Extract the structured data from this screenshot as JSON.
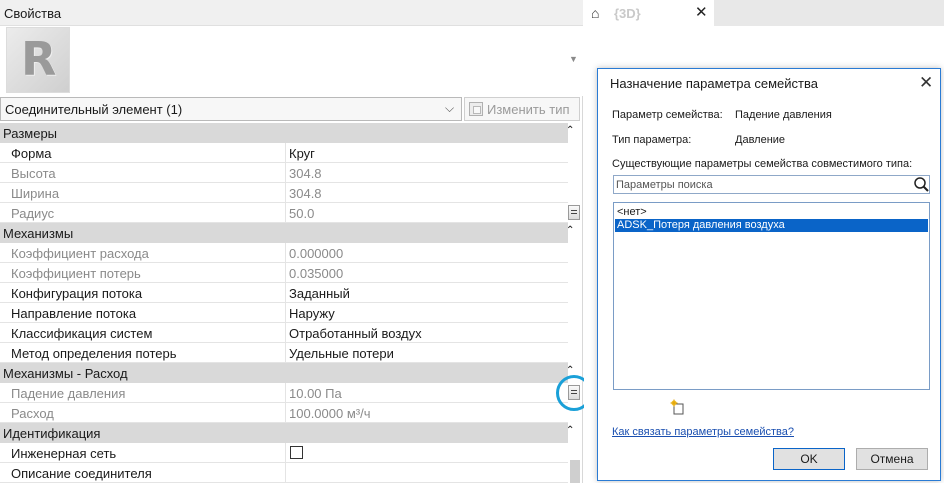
{
  "properties_palette": {
    "title": "Свойства",
    "type_thumbnail_letter": "R",
    "selector_label": "Соединительный элемент (1)",
    "edit_type_label": "Изменить тип",
    "groups": [
      {
        "label": "Размеры",
        "rows": [
          {
            "name": "Форма",
            "value": "Круг",
            "dim": false
          },
          {
            "name": "Высота",
            "value": "304.8",
            "dim": true
          },
          {
            "name": "Ширина",
            "value": "304.8",
            "dim": true
          },
          {
            "name": "Радиус",
            "value": "50.0",
            "dim": true,
            "assoc": true
          }
        ]
      },
      {
        "label": "Механизмы",
        "rows": [
          {
            "name": "Коэффициент расхода",
            "value": "0.000000",
            "dim": true
          },
          {
            "name": "Коэффициент потерь",
            "value": "0.035000",
            "dim": true
          },
          {
            "name": "Конфигурация потока",
            "value": "Заданный",
            "dim": false
          },
          {
            "name": "Направление потока",
            "value": "Наружу",
            "dim": false
          },
          {
            "name": "Классификация систем",
            "value": "Отработанный воздух",
            "dim": false
          },
          {
            "name": "Метод определения потерь",
            "value": "Удельные потери",
            "dim": false
          }
        ]
      },
      {
        "label": "Механизмы - Расход",
        "rows": [
          {
            "name": "Падение давления",
            "value": "10.00 Па",
            "dim": true,
            "assoc": true
          },
          {
            "name": "Расход",
            "value": "100.0000 м³/ч",
            "dim": true
          }
        ]
      },
      {
        "label": "Идентификация",
        "rows": [
          {
            "name": "Инженерная сеть",
            "value": "",
            "dim": false,
            "checkbox": true,
            "checked": false
          },
          {
            "name": "Описание соединителя",
            "value": "",
            "dim": false
          }
        ]
      }
    ]
  },
  "view_tab": {
    "label": "{3D}",
    "close_glyph": "✕"
  },
  "dialog": {
    "title": "Назначение параметра семейства",
    "close_glyph": "✕",
    "family_param_label": "Параметр семейства:",
    "family_param_value": "Падение давления",
    "param_type_label": "Тип параметра:",
    "param_type_value": "Давление",
    "existing_label": "Существующие параметры семейства совместимого типа:",
    "search_placeholder": "Параметры поиска",
    "list_items": [
      {
        "label": "<нет>",
        "selected": false
      },
      {
        "label": "ADSK_Потеря давления воздуха",
        "selected": true
      }
    ],
    "help_link": "Как связать параметры семейства?",
    "ok_label": "OK",
    "cancel_label": "Отмена"
  },
  "colors": {
    "accent": "#0a64c8",
    "highlight_ring": "#1aa0d8",
    "group_header_bg": "#d9d9d9"
  }
}
